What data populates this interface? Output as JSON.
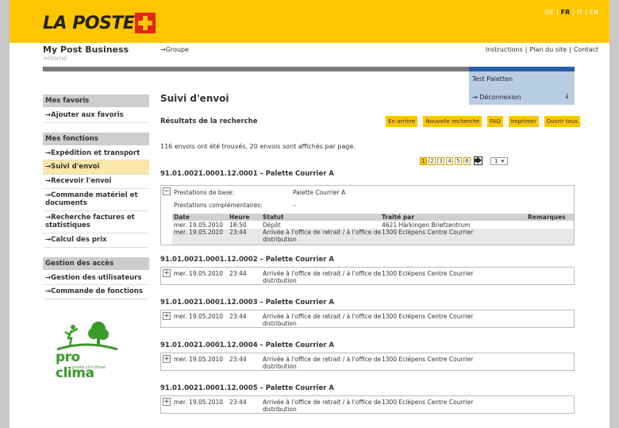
{
  "header": {
    "logo_text": "LA POSTE",
    "languages": [
      {
        "label": "DE",
        "selected": false
      },
      {
        "label": "FR",
        "selected": true
      },
      {
        "label": "IT",
        "selected": false
      },
      {
        "label": "EN",
        "selected": false
      }
    ],
    "app_name": "My Post Business",
    "breadcrumb": ">Home",
    "group_link": "→Groupe",
    "links": [
      "Instructions",
      "Plan du site",
      "Contact"
    ],
    "user_name": "Test Paletten",
    "logout": "→ Déconnexion",
    "logout_arrow": "↓"
  },
  "sidebar": {
    "favs_title": "Mes favoris",
    "favs": [
      "→Ajouter aux favoris"
    ],
    "func_title": "Mes fonctions",
    "funcs": [
      {
        "label": "→Expédition et transport",
        "active": false
      },
      {
        "label": "→Suivi d'envoi",
        "active": true
      },
      {
        "label": "→Recevoir l'envoi",
        "active": false
      },
      {
        "label": "→Commande matériel et documents",
        "active": false
      },
      {
        "label": "→Recherche factures et statistiques",
        "active": false
      },
      {
        "label": "→Calcul des prix",
        "active": false
      }
    ],
    "access_title": "Gestion des accès",
    "access": [
      "→Gestion des utilisateurs",
      "→Commande de fonctions"
    ],
    "logo_text": "pro clima",
    "logo_sub": "poste.ch/climat"
  },
  "main": {
    "title": "Suivi d'envoi",
    "results_title": "Résultats de la recherche",
    "buttons": [
      "En arrière",
      "Nouvelle recherche",
      "FAQ",
      "Imprimer",
      "Ouvrir tous"
    ],
    "summary": "116 envois ont été trouvés. 20 envois sont affichés par page.",
    "pages": [
      "1",
      "2",
      "3",
      "4",
      "5",
      "6"
    ],
    "current_page": "1",
    "page_select": "1",
    "next_icon": "🡆",
    "expanded": {
      "title": "91.01.0021.0001.12.0001 – Palette Courrier A",
      "toggle": "−",
      "base_label": "Prestations de base:",
      "base_value": "Palette Courrier A",
      "extra_label": "Prestations complémentaires:",
      "extra_value": "–",
      "columns": [
        "Date",
        "Heure",
        "Statut",
        "Traité par",
        "Remarques"
      ],
      "rows": [
        {
          "date": "mer. 19.05.2010",
          "time": "18:50",
          "status": "Dépôt",
          "by": "4621 Härkingen Briefzentrum",
          "remark": ""
        },
        {
          "date": "mer. 19.05.2010",
          "time": "23:44",
          "status": "Arrivée à l'office de retrait / à l'office de distribution",
          "by": "1300 Eclépens Centre Courrier",
          "remark": ""
        }
      ]
    },
    "collapsed": [
      {
        "title": "91.01.0021.0001.12.0002 – Palette Courrier A",
        "toggle": "+",
        "date": "mer. 19.05.2010",
        "time": "23:44",
        "status": "Arrivée à l'office de retrait / à l'office de distribution",
        "by": "1300 Eclépens Centre Courrier"
      },
      {
        "title": "91.01.0021.0001.12.0003 – Palette Courrier A",
        "toggle": "+",
        "date": "mer. 19.05.2010",
        "time": "23:44",
        "status": "Arrivée à l'office de retrait / à l'office de distribution",
        "by": "1300 Eclépens Centre Courrier"
      },
      {
        "title": "91.01.0021.0001.12.0004 – Palette Courrier A",
        "toggle": "+",
        "date": "mer. 19.05.2010",
        "time": "23:44",
        "status": "Arrivée à l'office de retrait / à l'office de distribution",
        "by": "1300 Eclépens Centre Courrier"
      },
      {
        "title": "91.01.0021.0001.12.0005 – Palette Courrier A",
        "toggle": "+",
        "date": "mer. 19.05.2010",
        "time": "23:44",
        "status": "Arrivée à l'office de retrait / à l'office de distribution",
        "by": "1300 Eclépens Centre Courrier"
      }
    ]
  },
  "colors": {
    "brand_yellow": "#fdc600",
    "brand_red": "#e2231a",
    "accent_blue": "#2a5da8",
    "green": "#3a9a2a"
  }
}
